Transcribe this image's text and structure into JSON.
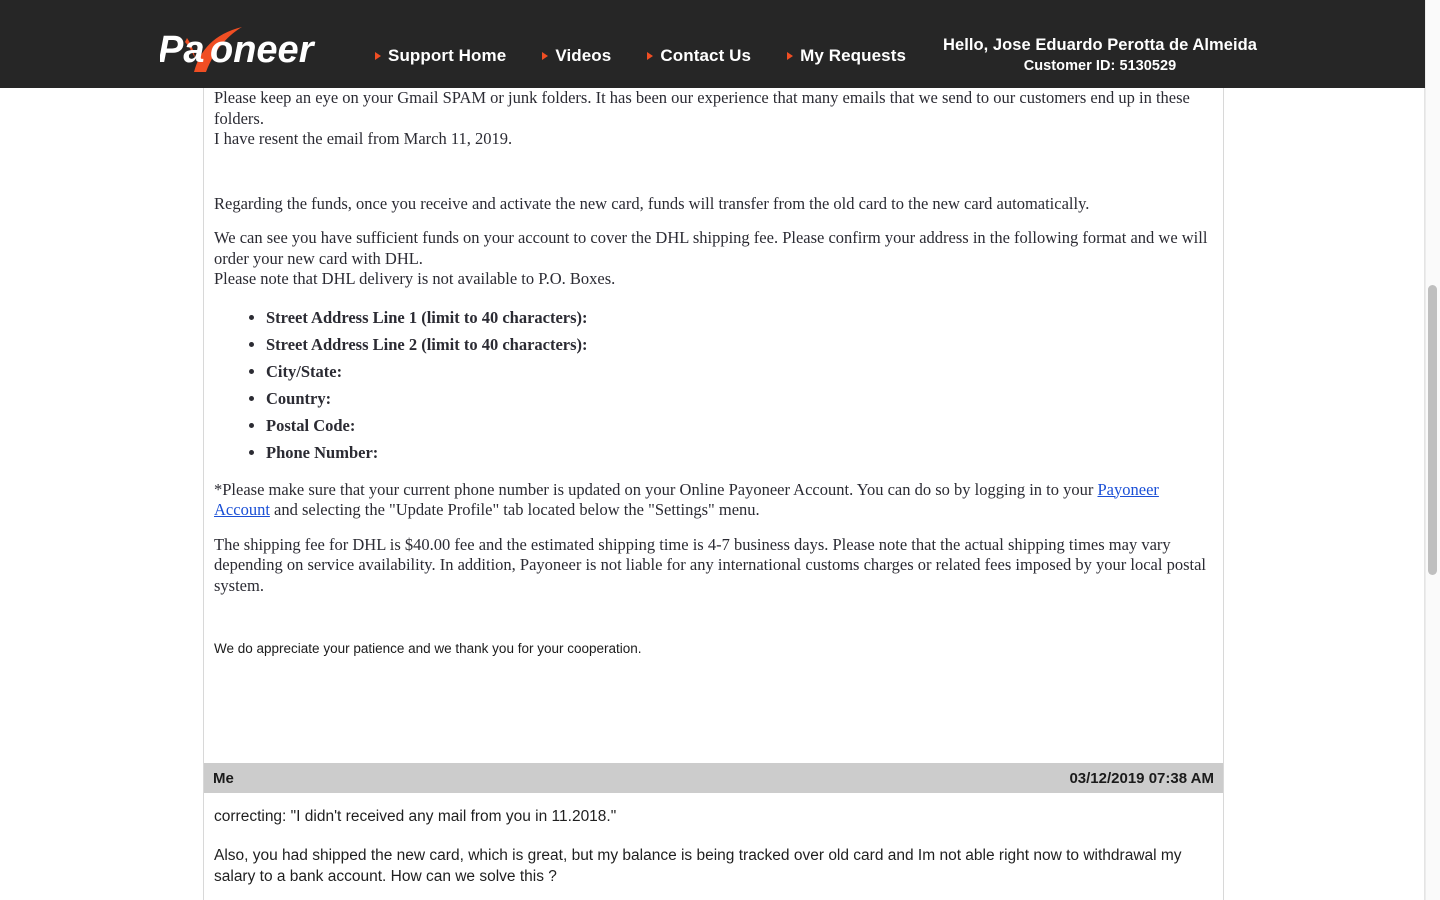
{
  "header": {
    "brand": "Payoneer",
    "nav": [
      {
        "label": "Support Home",
        "icon": "triangle-right-icon"
      },
      {
        "label": "Videos",
        "icon": "triangle-right-icon"
      },
      {
        "label": "Contact Us",
        "icon": "triangle-right-icon"
      },
      {
        "label": "My Requests",
        "icon": "triangle-right-icon"
      }
    ],
    "greeting": "Hello, Jose Eduardo Perotta de Almeida",
    "customer_id": "Customer ID: 5130529",
    "background_color": "#262626",
    "accent_color": "#f04e23"
  },
  "agent_message": {
    "paragraph_1": "Please keep an eye on your Gmail SPAM or junk folders.  It has been our experience that many emails that we send to our customers end up in these folders.",
    "paragraph_2": "I have resent the email from March 11, 2019.",
    "paragraph_3": "Regarding the funds, once you receive and activate the new card, funds will transfer from the old card to the new card automatically.",
    "paragraph_4": "We can see you have sufficient funds on your account to cover the DHL shipping fee. Please confirm your address in the following format and we will order your new card with DHL.",
    "paragraph_5": "Please note that DHL delivery is not available to P.O. Boxes.",
    "address_fields": [
      "Street Address Line 1 (limit to 40 characters):",
      "Street Address Line 2 (limit to 40 characters):",
      "City/State:",
      "Country:",
      "Postal Code:",
      "Phone Number:"
    ],
    "phone_note_before_link": "*Please make sure that your current phone number is updated on your Online Payoneer Account. You can do so by logging in to your ",
    "phone_note_link": "Payoneer Account",
    "phone_note_after_link": " and selecting the \"Update Profile\" tab located below the \"Settings\" menu.",
    "shipping_note": "The shipping fee for DHL is $40.00 fee and the estimated shipping time is 4-7 business days. Please note that the actual shipping times may vary depending on service availability. In addition, Payoneer is not liable for any international customs charges or related fees imposed by your local postal system.",
    "closing": "We do appreciate your patience and we thank you for your cooperation.",
    "link_color": "#1a4fd6"
  },
  "user_message": {
    "author": "Me",
    "timestamp": "03/12/2019 07:38 AM",
    "header_background": "#cccccc",
    "paragraph_1": "correcting: \"I didn't received any mail from you in 11.2018.\"",
    "paragraph_2": "Also, you had shipped the new card, which is great, but my balance is being tracked over old card and Im not able right now to withdrawal my salary to a bank account. How can we solve this ?"
  },
  "scrollbar": {
    "name": "vertical-scrollbar",
    "thumb_color": "#bfbfbf"
  }
}
